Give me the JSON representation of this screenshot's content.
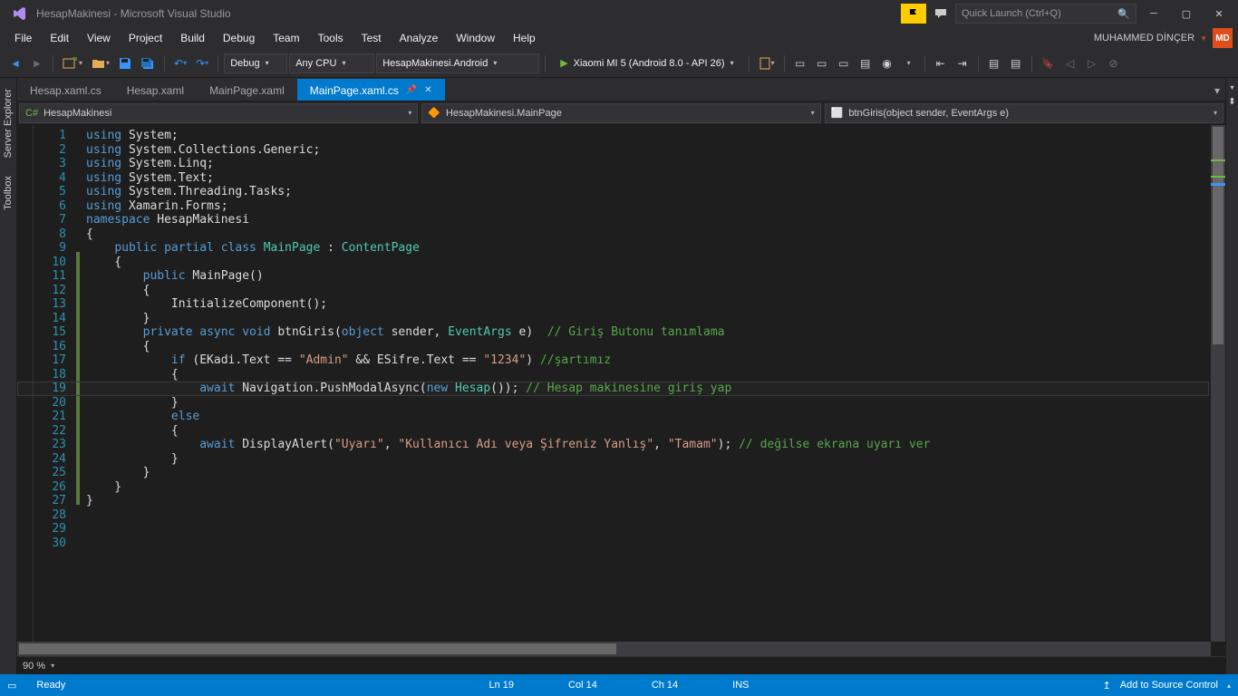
{
  "title": "HesapMakinesi - Microsoft Visual Studio",
  "quick_launch_placeholder": "Quick Launch (Ctrl+Q)",
  "menu": [
    "File",
    "Edit",
    "View",
    "Project",
    "Build",
    "Debug",
    "Team",
    "Tools",
    "Test",
    "Analyze",
    "Window",
    "Help"
  ],
  "user": {
    "name": "MUHAMMED DİNÇER",
    "initials": "MD"
  },
  "toolbar": {
    "config": "Debug",
    "platform": "Any CPU",
    "startup": "HesapMakinesi.Android",
    "target": "Xiaomi MI 5 (Android 8.0 - API 26)"
  },
  "side_tabs": [
    "Server Explorer",
    "Toolbox"
  ],
  "doc_tabs": [
    {
      "label": "Hesap.xaml.cs",
      "active": false
    },
    {
      "label": "Hesap.xaml",
      "active": false
    },
    {
      "label": "MainPage.xaml",
      "active": false
    },
    {
      "label": "MainPage.xaml.cs",
      "active": true
    }
  ],
  "nav": {
    "project": "HesapMakinesi",
    "class": "HesapMakinesi.MainPage",
    "member": "btnGiris(object sender, EventArgs e)"
  },
  "code_lines": [
    {
      "n": 1,
      "t": [
        [
          "kw",
          "using "
        ],
        [
          "ident",
          "System;"
        ]
      ]
    },
    {
      "n": 2,
      "t": [
        [
          "kw",
          "using "
        ],
        [
          "ident",
          "System.Collections.Generic;"
        ]
      ]
    },
    {
      "n": 3,
      "t": [
        [
          "kw",
          "using "
        ],
        [
          "ident",
          "System.Linq;"
        ]
      ]
    },
    {
      "n": 4,
      "t": [
        [
          "kw",
          "using "
        ],
        [
          "ident",
          "System.Text;"
        ]
      ]
    },
    {
      "n": 5,
      "t": [
        [
          "kw",
          "using "
        ],
        [
          "ident",
          "System.Threading.Tasks;"
        ]
      ]
    },
    {
      "n": 6,
      "t": [
        [
          "kw",
          "using "
        ],
        [
          "ident",
          "Xamarin.Forms;"
        ]
      ]
    },
    {
      "n": 7,
      "t": [
        [
          "",
          ""
        ]
      ]
    },
    {
      "n": 8,
      "t": [
        [
          "kw",
          "namespace "
        ],
        [
          "ident",
          "HesapMakinesi"
        ]
      ]
    },
    {
      "n": 9,
      "t": [
        [
          "ident",
          "{"
        ]
      ]
    },
    {
      "n": 10,
      "t": [
        [
          "ident",
          "    "
        ],
        [
          "kw",
          "public partial class "
        ],
        [
          "type",
          "MainPage"
        ],
        [
          "ident",
          " : "
        ],
        [
          "type",
          "ContentPage"
        ]
      ]
    },
    {
      "n": 11,
      "t": [
        [
          "ident",
          "    {"
        ]
      ]
    },
    {
      "n": 12,
      "t": [
        [
          "ident",
          "        "
        ],
        [
          "kw",
          "public "
        ],
        [
          "ident",
          "MainPage()"
        ]
      ]
    },
    {
      "n": 13,
      "t": [
        [
          "ident",
          "        {"
        ]
      ]
    },
    {
      "n": 14,
      "t": [
        [
          "ident",
          "            InitializeComponent();"
        ]
      ]
    },
    {
      "n": 15,
      "t": [
        [
          "ident",
          "        }"
        ]
      ]
    },
    {
      "n": 16,
      "t": [
        [
          "ident",
          "        "
        ],
        [
          "kw",
          "private async void "
        ],
        [
          "ident",
          "btnGiris("
        ],
        [
          "kw",
          "object"
        ],
        [
          "ident",
          " sender, "
        ],
        [
          "type",
          "EventArgs"
        ],
        [
          "ident",
          " e)  "
        ],
        [
          "cmt",
          "// Giriş Butonu tanımlama"
        ]
      ]
    },
    {
      "n": 17,
      "t": [
        [
          "ident",
          "        { "
        ]
      ]
    },
    {
      "n": 18,
      "t": [
        [
          "ident",
          "            "
        ],
        [
          "kw",
          "if "
        ],
        [
          "ident",
          "(EKadi.Text == "
        ],
        [
          "str",
          "\"Admin\""
        ],
        [
          "ident",
          " && ESifre.Text == "
        ],
        [
          "str",
          "\"1234\""
        ],
        [
          "ident",
          ") "
        ],
        [
          "cmt",
          "//şartımız"
        ]
      ]
    },
    {
      "n": 19,
      "t": [
        [
          "ident",
          "            {"
        ]
      ],
      "current": true
    },
    {
      "n": 20,
      "t": [
        [
          "",
          ""
        ]
      ]
    },
    {
      "n": 21,
      "t": [
        [
          "ident",
          "                "
        ],
        [
          "kw",
          "await "
        ],
        [
          "ident",
          "Navigation.PushModalAsync("
        ],
        [
          "kw",
          "new "
        ],
        [
          "type",
          "Hesap"
        ],
        [
          "ident",
          "()); "
        ],
        [
          "cmt",
          "// Hesap makinesine giriş yap"
        ]
      ]
    },
    {
      "n": 22,
      "t": [
        [
          "ident",
          "            }"
        ]
      ]
    },
    {
      "n": 23,
      "t": [
        [
          "ident",
          "            "
        ],
        [
          "kw",
          "else"
        ]
      ]
    },
    {
      "n": 24,
      "t": [
        [
          "ident",
          "            {"
        ]
      ]
    },
    {
      "n": 25,
      "t": [
        [
          "ident",
          "                "
        ],
        [
          "kw",
          "await "
        ],
        [
          "ident",
          "DisplayAlert("
        ],
        [
          "str",
          "\"Uyarı\""
        ],
        [
          "ident",
          ", "
        ],
        [
          "str",
          "\"Kullanıcı Adı veya Şifreniz Yanlış\""
        ],
        [
          "ident",
          ", "
        ],
        [
          "str",
          "\"Tamam\""
        ],
        [
          "ident",
          "); "
        ],
        [
          "cmt",
          "// değilse ekrana uyarı ver"
        ]
      ]
    },
    {
      "n": 26,
      "t": [
        [
          "ident",
          "            } "
        ]
      ]
    },
    {
      "n": 27,
      "t": [
        [
          "ident",
          "        }"
        ]
      ]
    },
    {
      "n": 28,
      "t": [
        [
          "ident",
          "    }"
        ]
      ]
    },
    {
      "n": 29,
      "t": [
        [
          "ident",
          "}"
        ]
      ]
    },
    {
      "n": 30,
      "t": [
        [
          "",
          ""
        ]
      ]
    }
  ],
  "zoom": "90 %",
  "status": {
    "ready": "Ready",
    "ln": "Ln 19",
    "col": "Col 14",
    "ch": "Ch 14",
    "ins": "INS",
    "source_ctrl": "Add to Source Control"
  }
}
